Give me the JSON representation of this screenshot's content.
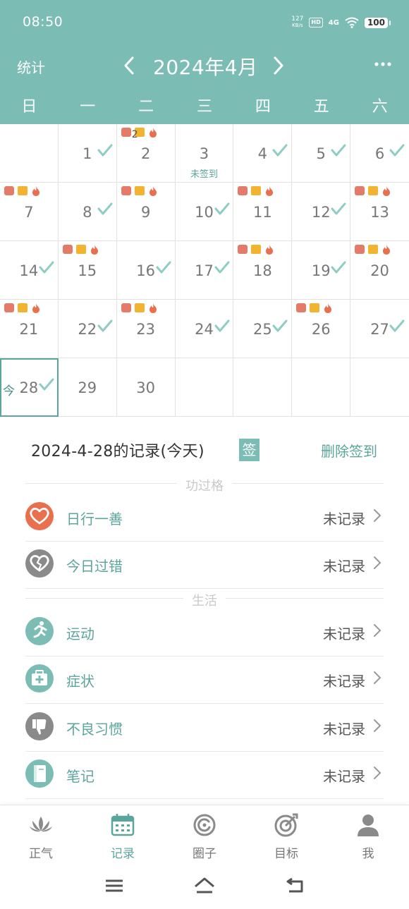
{
  "status_bar": {
    "time": "08:50",
    "net_speed_value": "127",
    "net_speed_unit": "KB/s",
    "hd": "HD",
    "network": "4G",
    "battery": "100"
  },
  "header": {
    "stats_label": "统计",
    "month_title": "2024年4月",
    "prev_icon": "chevron-left-icon",
    "next_icon": "chevron-right-icon",
    "more_icon": "more-dots-icon"
  },
  "weekdays": [
    "日",
    "一",
    "二",
    "三",
    "四",
    "五",
    "六"
  ],
  "calendar": {
    "unsigned_text": "未签到",
    "today_tag": "今",
    "mark_count_day2": "2",
    "days": [
      "1",
      "2",
      "3",
      "4",
      "5",
      "6",
      "7",
      "8",
      "9",
      "10",
      "11",
      "12",
      "13",
      "14",
      "15",
      "16",
      "17",
      "18",
      "19",
      "20",
      "21",
      "22",
      "23",
      "24",
      "25",
      "26",
      "27",
      "28",
      "29",
      "30"
    ]
  },
  "record": {
    "title": "2024-4-28的记录(今天)",
    "sign_badge": "签",
    "delete_label": "删除签到"
  },
  "sections": {
    "merit": "功过格",
    "life": "生活"
  },
  "rows": [
    {
      "label": "日行一善",
      "status": "未记录",
      "icon": "heart-icon",
      "color": "#e8704f"
    },
    {
      "label": "今日过错",
      "status": "未记录",
      "icon": "broken-heart-icon",
      "color": "#8a8a8a"
    },
    {
      "label": "运动",
      "status": "未记录",
      "icon": "running-icon",
      "color": "#7bbdb4"
    },
    {
      "label": "症状",
      "status": "未记录",
      "icon": "medical-kit-icon",
      "color": "#7bbdb4"
    },
    {
      "label": "不良习惯",
      "status": "未记录",
      "icon": "thumbs-down-icon",
      "color": "#8a8a8a"
    },
    {
      "label": "笔记",
      "status": "未记录",
      "icon": "notebook-icon",
      "color": "#7bbdb4"
    }
  ],
  "tabs": [
    {
      "label": "正气",
      "icon": "lotus-icon",
      "active": false
    },
    {
      "label": "记录",
      "icon": "calendar-icon",
      "active": true
    },
    {
      "label": "圈子",
      "icon": "circle-community-icon",
      "active": false
    },
    {
      "label": "目标",
      "icon": "target-icon",
      "active": false
    },
    {
      "label": "我",
      "icon": "person-icon",
      "active": false
    }
  ],
  "colors": {
    "accent": "#7bbdb4",
    "accent_text": "#5aa69c",
    "mark_red": "#e37b68",
    "mark_yellow": "#f2b430"
  }
}
